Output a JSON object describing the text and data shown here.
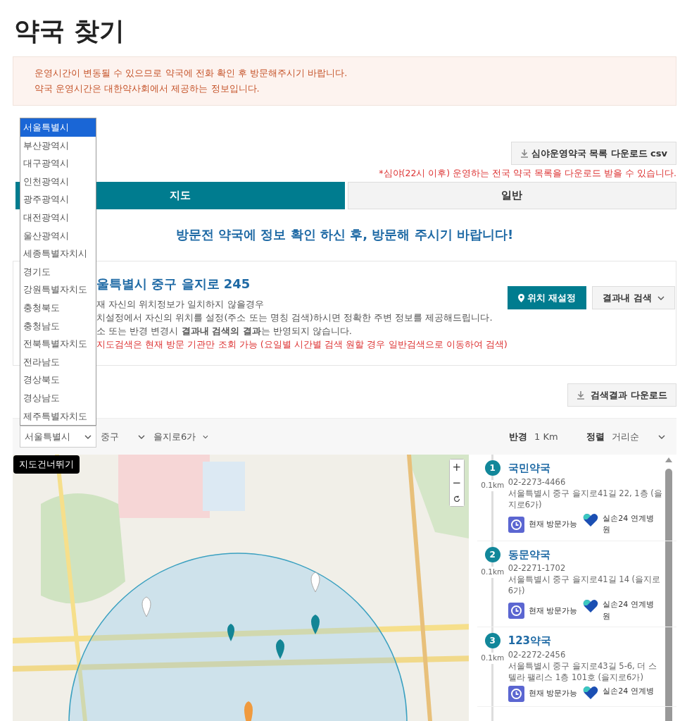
{
  "title": "약국 찾기",
  "notice": [
    "운영시간이 변동될 수 있으므로 약국에 전화 확인 후 방문해주시기 바랍니다.",
    "약국 운영시간은 대한약사회에서 제공하는 정보입니다."
  ],
  "region_dropdown": [
    {
      "label": "서울특별시",
      "selected": true
    },
    {
      "label": "부산광역시",
      "selected": false
    },
    {
      "label": "대구광역시",
      "selected": false
    },
    {
      "label": "인천광역시",
      "selected": false
    },
    {
      "label": "광주광역시",
      "selected": false
    },
    {
      "label": "대전광역시",
      "selected": false
    },
    {
      "label": "울산광역시",
      "selected": false
    },
    {
      "label": "세종특별자치시",
      "selected": false
    },
    {
      "label": "경기도",
      "selected": false
    },
    {
      "label": "강원특별자치도",
      "selected": false
    },
    {
      "label": "충청북도",
      "selected": false
    },
    {
      "label": "충청남도",
      "selected": false
    },
    {
      "label": "전북특별자치도",
      "selected": false
    },
    {
      "label": "전라남도",
      "selected": false
    },
    {
      "label": "경상북도",
      "selected": false
    },
    {
      "label": "경상남도",
      "selected": false
    },
    {
      "label": "제주특별자치도",
      "selected": false
    }
  ],
  "csv_button": "심야운영약국 목록 다운로드 csv",
  "csv_note": "*심야(22시 이후) 운영하는 전국 약국 목록을 다운로드 받을 수 있습니다.",
  "tabs": [
    {
      "label": "지도",
      "selected": true
    },
    {
      "label": "일반",
      "selected": false
    }
  ],
  "heading": "방문전 약국에 정보 확인 하신 후, 방문해 주시기 바랍니다!",
  "location": {
    "address": "울특별시 중구 을지로 245",
    "lines": [
      {
        "text": "재 자신의 위치정보가 일치하지 않을경우",
        "kind": "normal"
      },
      {
        "text": "치설정에서 자신의 위치를 설정(주소 또는 명칭 검색)하시면 정확한 주변 정보를 제공해드립니다.",
        "kind": "normal"
      },
      {
        "text": "소 또는 반경 변경시 **결과내 검색의 결과**는 반영되지 않습니다.",
        "kind": "normal"
      },
      {
        "text": "지도검색은 현재 방문 기관만 조회 가능 (요일별 시간별 검색 원할 경우 일반검색으로 이동하여 검색)",
        "kind": "warning"
      }
    ],
    "reset_button": "위치 재설정",
    "filter_button": "결과내 검색"
  },
  "results_download": "검색결과 다운로드",
  "filters": {
    "region": "서울특별시",
    "district": "중구",
    "dong": "을지로6가",
    "radius_label": "반경",
    "radius": "1 Km",
    "sort_label": "정렬",
    "sort": "거리순"
  },
  "map": {
    "skip_button": "지도건너뛰기",
    "zoom_in": "+",
    "zoom_out": "−"
  },
  "pharmacies": [
    {
      "number": "1",
      "distance": "0.1km",
      "name": "국민약국",
      "phone": "02-2273-4466",
      "address": "서울특별시 중구 을지로41길 22, 1층 (을지로6가)",
      "visit": "현재 방문가능",
      "linked": "실손24 연계병원"
    },
    {
      "number": "2",
      "distance": "0.1km",
      "name": "동문약국",
      "phone": "02-2271-1702",
      "address": "서울특별시 중구 을지로41길 14 (을지로6가)",
      "visit": "현재 방문가능",
      "linked": "실손24 연계병원"
    },
    {
      "number": "3",
      "distance": "0.1km",
      "name": "123약국",
      "phone": "02-2272-2456",
      "address": "서울특별시 중구 을지로43길 5-6, 더 스텔라 팰리스 1층 101호 (을지로6가)",
      "visit": "현재 방문가능",
      "linked": "실손24 연계병"
    }
  ]
}
